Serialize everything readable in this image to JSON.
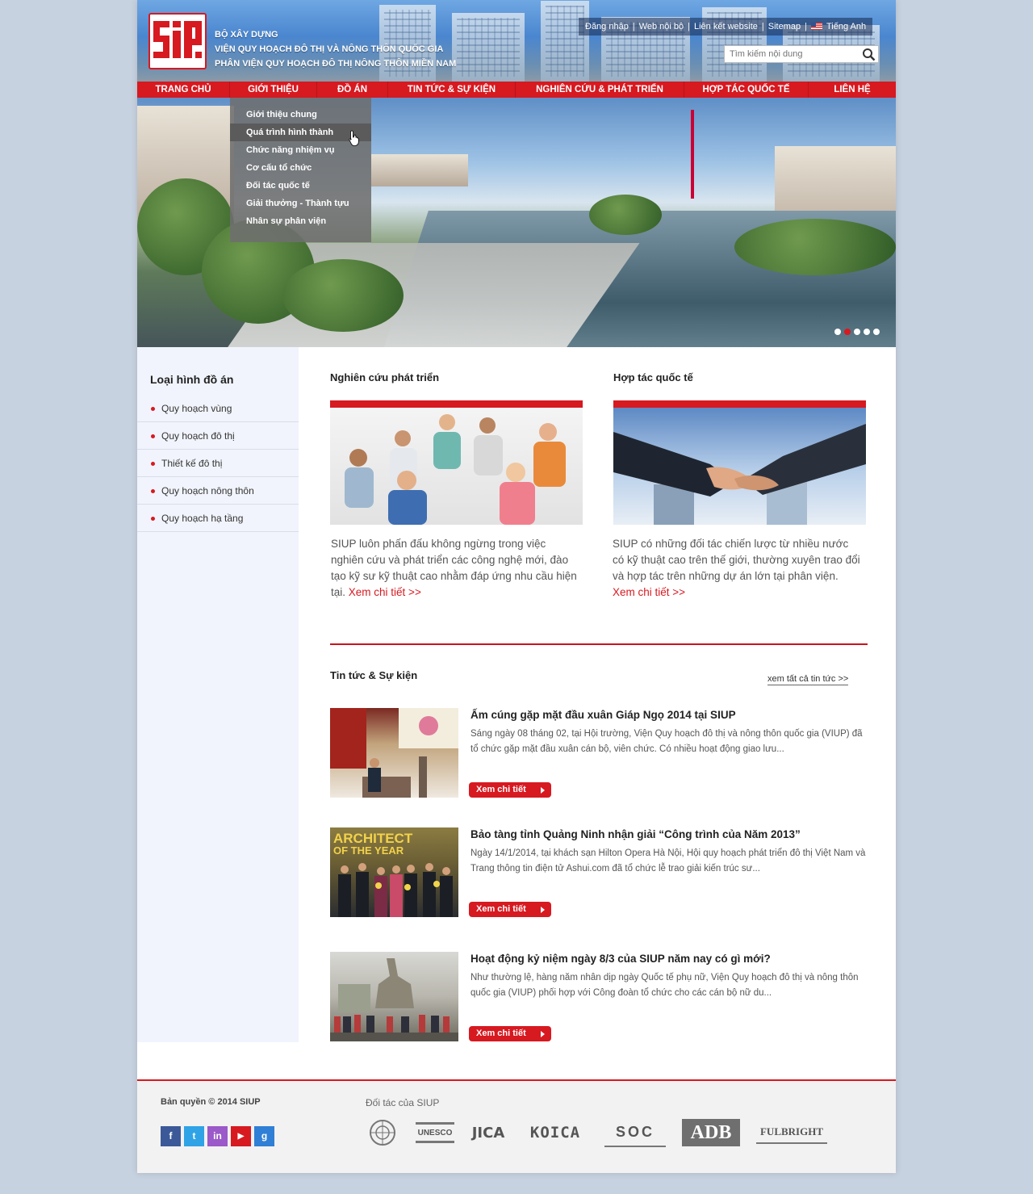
{
  "header": {
    "org_line1": "BỘ XÂY DỰNG",
    "org_line2": "VIỆN QUY HOẠCH ĐÔ THỊ VÀ NÔNG THÔN QUỐC GIA",
    "org_line3": "PHÂN VIỆN QUY HOẠCH ĐÔ THỊ NÔNG THÔN MIỀN NAM",
    "logo_text": "SIUP",
    "top_links": [
      "Đăng nhập",
      "Web nội bộ",
      "Liên kết website",
      "Sitemap"
    ],
    "separator": "|",
    "language": "Tiếng Anh",
    "search_placeholder": "Tìm kiếm nội dung"
  },
  "nav": [
    "TRANG CHỦ",
    "GIỚI THIỆU",
    "ĐỒ ÁN",
    "TIN TỨC & SỰ KIỆN",
    "NGHIÊN CỨU & PHÁT TRIỂN",
    "HỢP TÁC QUỐC TẾ",
    "LIÊN HỆ"
  ],
  "dropdown": [
    "Giới thiệu chung",
    "Quá trình hình thành",
    "Chức năng nhiệm vụ",
    "Cơ cấu tổ chức",
    "Đối tác quốc tế",
    "Giải thưởng - Thành tựu",
    "Nhân sự phân viện"
  ],
  "sidebar": {
    "title": "Loại hình đồ án",
    "items": [
      "Quy hoạch vùng",
      "Quy hoạch đô thị",
      "Thiết kế đô thị",
      "Quy hoạch nông thôn",
      "Quy hoạch hạ tầng"
    ]
  },
  "features": [
    {
      "title": "Nghiên cứu phát triển",
      "text": "SIUP luôn phấn đấu không ngừng trong việc nghiên cứu và phát triển các công nghệ mới, đào tạo kỹ sư kỹ thuật cao nhằm đáp ứng nhu cầu hiện tại.",
      "more": "Xem chi tiết >>"
    },
    {
      "title": "Hợp tác quốc tế",
      "text": "SIUP có những đối tác chiến lược từ nhiều nước có kỹ thuật cao trên thế giới, thường xuyên trao đổi và hợp tác trên những dự án lớn tại phân viện.",
      "more": "Xem chi tiết >>"
    }
  ],
  "news": {
    "title": "Tin tức & Sự kiện",
    "view_all": "xem tất cả tin tức >>",
    "button_label": "Xem chi tiết",
    "items": [
      {
        "headline": "Ấm cúng gặp mặt đầu xuân Giáp Ngọ 2014 tại SIUP",
        "summary": "Sáng ngày 08 tháng 02, tại Hội trường, Viện Quy hoạch đô thị và nông thôn quốc gia (VIUP) đã tổ chức gặp mặt đầu xuân cán bộ, viên chức. Có nhiều hoạt động giao lưu..."
      },
      {
        "headline": "Bảo tàng tỉnh Quảng Ninh nhận giải “Công trình của Năm 2013”",
        "summary": "Ngày 14/1/2014, tại khách sạn Hilton Opera Hà Nội, Hội quy hoạch phát triển đô thị Việt Nam và Trang thông tin điện tử Ashui.com đã tổ chức lễ trao giải kiến trúc sư...",
        "thumb_caption_1": "ARCHITECT",
        "thumb_caption_2": "OF THE YEAR"
      },
      {
        "headline": "Hoạt động kỷ niệm ngày 8/3 của SIUP năm nay có gì mới?",
        "summary": "Như thường lệ, hàng năm nhân dịp ngày Quốc tế phụ nữ, Viện Quy hoạch đô thị và nông thôn quốc gia (VIUP) phối hợp với Công đoàn tổ chức cho các cán bộ nữ du..."
      }
    ]
  },
  "footer": {
    "copyright": "Bản quyền © 2014 SIUP",
    "social": [
      {
        "name": "facebook",
        "glyph": "f",
        "color": "#3b5998"
      },
      {
        "name": "twitter",
        "glyph": "t",
        "color": "#2fa3e6"
      },
      {
        "name": "linkedin",
        "glyph": "in",
        "color": "#9b59c9"
      },
      {
        "name": "youtube",
        "glyph": "▶",
        "color": "#d71920"
      },
      {
        "name": "google-plus",
        "glyph": "g",
        "color": "#2f7fd6"
      }
    ],
    "partners_label": "Đối tác của SIUP",
    "partners": [
      "UN",
      "UNESCO",
      "JICA",
      "KOICA",
      "SOC",
      "ADB",
      "FULBRIGHT"
    ]
  },
  "colors": {
    "brand_red": "#d71920",
    "sidebar_bg": "#f1f4fc",
    "page_bg": "#c7d2e0"
  },
  "banner": {
    "slide_count": 5,
    "active_slide": 2
  }
}
